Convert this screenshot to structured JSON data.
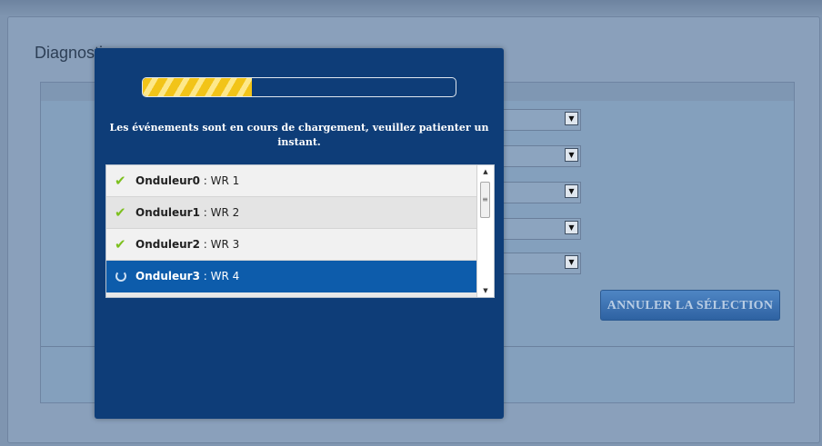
{
  "page": {
    "title": "Diagnostic"
  },
  "actions": {
    "cancel_label": "ANNULER LA SÉLECTION"
  },
  "modal": {
    "progress": 0.35,
    "message": "Les événements sont en cours de chargement, veuillez patienter un instant.",
    "items": [
      {
        "name": "Onduleur0",
        "sep": " : ",
        "value": "WR 1",
        "status": "done",
        "icon": "check-icon"
      },
      {
        "name": "Onduleur1",
        "sep": " : ",
        "value": "WR 2",
        "status": "done",
        "icon": "check-icon"
      },
      {
        "name": "Onduleur2",
        "sep": " : ",
        "value": "WR 3",
        "status": "done",
        "icon": "check-icon"
      },
      {
        "name": "Onduleur3",
        "sep": " : ",
        "value": "WR 4",
        "status": "loading",
        "icon": "spinner-icon"
      }
    ]
  },
  "colors": {
    "modal_bg": "#0e3d78",
    "progress_fill": "#f2c418",
    "active_row": "#0d5cab",
    "check": "#7dc01f"
  }
}
